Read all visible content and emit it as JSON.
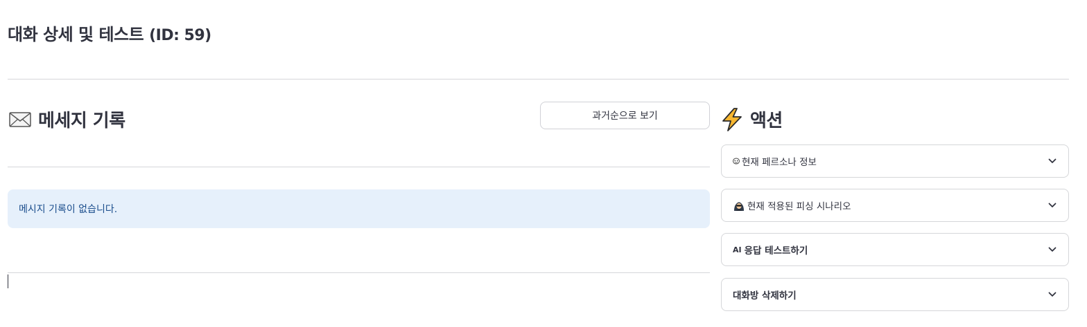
{
  "header": {
    "title": "대화 상세 및 테스트",
    "id_label": "(ID: 59)"
  },
  "messages": {
    "title": "메세지 기록",
    "title_icon": "envelope-icon",
    "sort_button_label": "과거순으로 보기",
    "empty_notice": "메시지 기록이 없습니다."
  },
  "actions": {
    "title": "액션",
    "title_icon": "lightning-icon",
    "expanders": [
      {
        "icon": "mask-icon",
        "label": "현재 페르소나 정보"
      },
      {
        "icon": "hacker-icon",
        "label": "현재 적용된 피싱 시나리오"
      },
      {
        "prefix": "AI",
        "label": "응답 테스트하기"
      },
      {
        "label": "대화방 삭제하기"
      }
    ]
  },
  "colors": {
    "text": "#31333f",
    "info_bg": "#e6f0fb",
    "info_text": "#1a4d8c",
    "border": "#d5d6d9",
    "lightning": "#f7b731"
  }
}
